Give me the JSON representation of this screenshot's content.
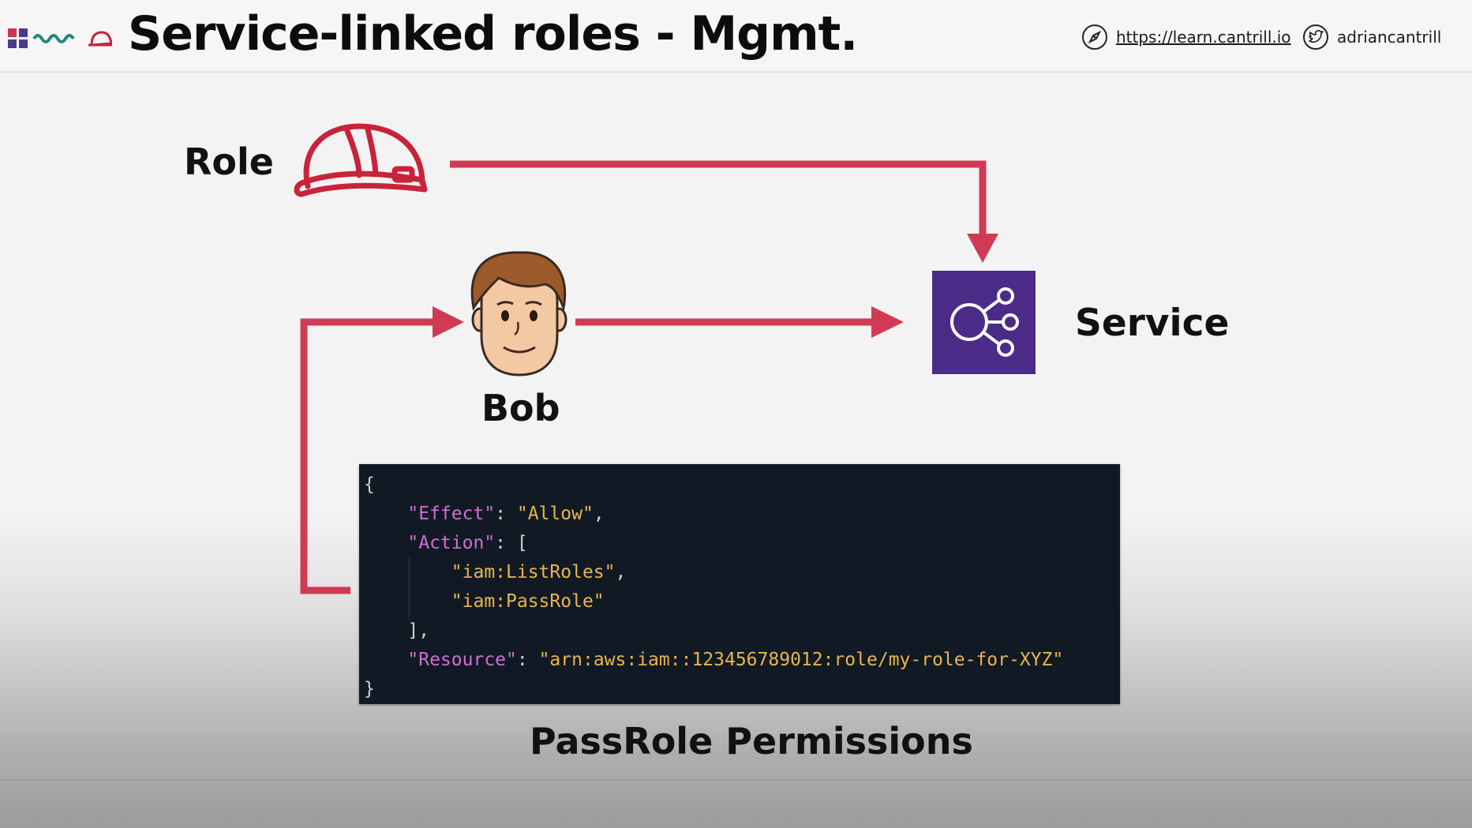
{
  "header": {
    "title": "Service-linked roles - Mgmt.",
    "website": "https://learn.cantrill.io",
    "twitter": "adriancantrill",
    "website_icon": "compass-icon",
    "twitter_icon": "twitter-bird-icon"
  },
  "diagram": {
    "role_label": "Role",
    "person_label": "Bob",
    "service_label": "Service",
    "role_icon": "hard-hat-icon",
    "person_icon": "person-avatar-icon",
    "service_icon": "aws-service-icon",
    "caption": "PassRole Permissions",
    "colors": {
      "arrow": "#d13a55",
      "hat": "#c8233b",
      "service_tile": "#4b2b87",
      "code_background": "#111a24",
      "code_key": "#d36cd3",
      "code_string": "#e9b54c"
    }
  },
  "policy": {
    "open_brace": "{",
    "effect_key": "\"Effect\"",
    "effect_value": "\"Allow\"",
    "action_key": "\"Action\"",
    "action_open": "[",
    "action_1": "\"iam:ListRoles\"",
    "action_2": "\"iam:PassRole\"",
    "action_close": "],",
    "resource_key": "\"Resource\"",
    "resource_value": "\"arn:aws:iam::123456789012:role/my-role-for-XYZ\"",
    "close_brace": "}"
  }
}
